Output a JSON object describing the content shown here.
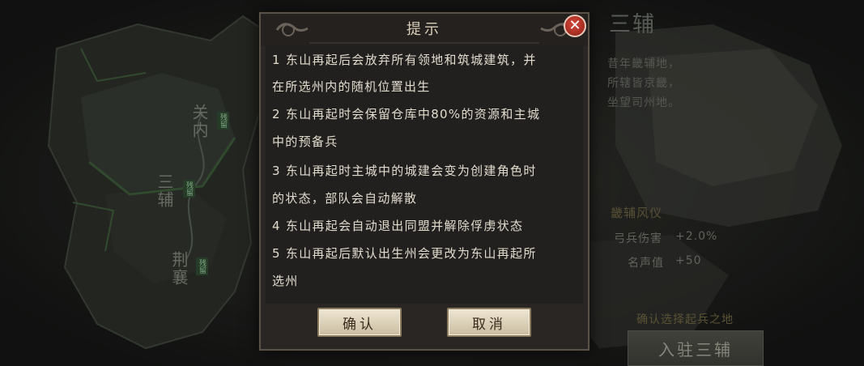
{
  "map": {
    "regions": [
      {
        "name": "关内",
        "tag": "残留"
      },
      {
        "name": "三辅",
        "tag": "残留"
      },
      {
        "name": "荆襄",
        "tag": "残留"
      }
    ]
  },
  "info_panel": {
    "region_name": "三辅",
    "description": [
      "昔年畿辅地，",
      "所辖皆京畿，",
      "坐望司州地。"
    ],
    "bonus_title": "畿辅风仪",
    "bonuses": [
      {
        "label": "弓兵伤害",
        "value": "+2.0%"
      },
      {
        "label": "名声值",
        "value": "+50"
      }
    ],
    "confirm_hint": "确认选择起兵之地",
    "enter_button": "入驻三辅"
  },
  "dialog": {
    "title": "提示",
    "close_icon": "close-icon",
    "lines": [
      "1 东山再起后会放弃所有领地和筑城建筑，并",
      "在所选州内的随机位置出生",
      "2 东山再起时会保留仓库中80%的资源和主城",
      "中的预备兵",
      "3 东山再起时主城中的城建会变为创建角色时",
      "的状态，部队会自动解散",
      "4 东山再起会自动退出同盟并解除俘虏状态",
      "5 东山再起后默认出生州会更改为东山再起所",
      "选州"
    ],
    "confirm_button": "确认",
    "cancel_button": "取消"
  },
  "colors": {
    "dialog_bg": "#2a2623",
    "button_bg": "#e4d9c0",
    "close_red": "#b83224",
    "accent_gold": "#6f6541"
  }
}
